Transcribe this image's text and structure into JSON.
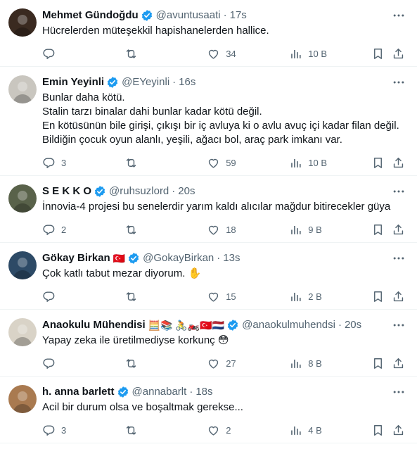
{
  "tweets": [
    {
      "name": "Mehmet Gündoğdu",
      "handle": "@avuntusaati",
      "time": "17s",
      "text": "Hücrelerden müteşekkil hapishanelerden hallice.",
      "replies": "",
      "retweets": "",
      "likes": "34",
      "views": "10 B",
      "avatar_color": "#3a2a20"
    },
    {
      "name": "Emin Yeyinli",
      "handle": "@EYeyinli",
      "time": "16s",
      "text": "Bunlar daha kötü.\nStalin tarzı binalar dahi bunlar kadar kötü değil.\nEn kötüsünün bile girişi, çıkışı bir iç avluya ki o avlu avuç içi kadar filan değil.\nBildiğin çocuk oyun alanlı, yeşili, ağacı bol, araç park imkanı var.",
      "replies": "3",
      "retweets": "",
      "likes": "59",
      "views": "10 B",
      "avatar_color": "#c9c6bf"
    },
    {
      "name": "S E K K O",
      "handle": "@ruhsuzlord",
      "time": "20s",
      "text": "İnnovia-4 projesi bu senelerdir yarım kaldı alıcılar mağdur bitirecekler güya",
      "replies": "2",
      "retweets": "",
      "likes": "18",
      "views": "9 B",
      "avatar_color": "#59624a"
    },
    {
      "name": "Gökay Birkan",
      "name_emoji": "🇹🇷",
      "handle": "@GokayBirkan",
      "time": "13s",
      "text": "Çok katlı tabut mezar diyorum. ✋",
      "replies": "",
      "retweets": "",
      "likes": "15",
      "views": "2 B",
      "avatar_color": "#2d4a66"
    },
    {
      "name": "Anaokulu Mühendisi",
      "name_emoji": "🧮📚 🚴🏍️🇹🇷🇳🇱",
      "handle": "@anaokulmuhendsi",
      "time": "20s",
      "text": "Yapay zeka ile üretilmediyse korkunç 😳",
      "replies": "",
      "retweets": "",
      "likes": "27",
      "views": "8 B",
      "avatar_color": "#d9d3c7"
    },
    {
      "name": "h. anna barlett",
      "handle": "@annabarlt",
      "time": "18s",
      "text": "Acil bir durum olsa ve boşaltmak gerekse...",
      "replies": "3",
      "retweets": "",
      "likes": "2",
      "views": "4 B",
      "avatar_color": "#a97a50"
    }
  ],
  "separator": "·",
  "accent": "#1d9bf0"
}
